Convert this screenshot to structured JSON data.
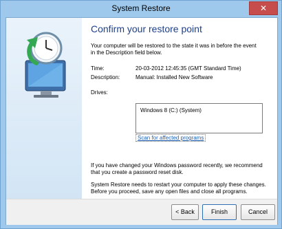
{
  "window": {
    "title": "System Restore",
    "close_glyph": "✕"
  },
  "main": {
    "heading": "Confirm your restore point",
    "intro_line1": "Your computer will be restored to the state it was in before the event",
    "intro_line2": "in the Description field below.",
    "time_label": "Time:",
    "time_value": "20-03-2012 12:45:35 (GMT Standard Time)",
    "description_label": "Description:",
    "description_value": "Manual: Installed New Software",
    "drives_label": "Drives:",
    "drives_items": [
      "Windows 8 (C:) (System)"
    ],
    "scan_link": "Scan for affected programs",
    "password_note_line1": "If you have changed your Windows password recently, we recommend",
    "password_note_line2": "that you create a password reset disk.",
    "restart_note_line1": "System Restore needs to restart your computer to apply these changes.",
    "restart_note_line2": "Before you proceed, save any open files and close all programs."
  },
  "footer": {
    "back_label": "< Back",
    "finish_label": "Finish",
    "cancel_label": "Cancel"
  },
  "icons": {
    "app_icon": "system-restore-icon"
  }
}
